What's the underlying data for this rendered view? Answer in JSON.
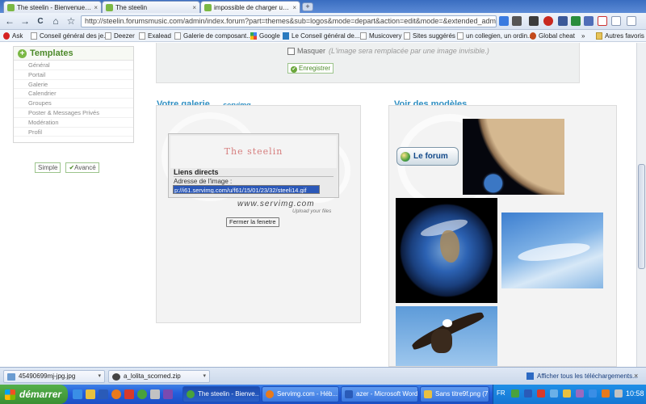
{
  "tabs": [
    {
      "label": "The steelin - Bienvenue sur...",
      "close": "×",
      "active": false
    },
    {
      "label": "The steelin",
      "close": "×",
      "active": false
    },
    {
      "label": "impossible de charger une i...",
      "close": "×",
      "active": true
    }
  ],
  "new_tab": "+",
  "toolbar": {
    "back": "←",
    "forward": "→",
    "reload": "C",
    "home": "⌂",
    "star": "☆",
    "url": "http://steelin.forumsmusic.com/admin/index.forum?part=themes&sub=logos&mode=depart&action=edit&mode=&extended_admin"
  },
  "bookmarks": [
    "Ask",
    "Conseil général des je...",
    "Deezer",
    "Exalead",
    "Galerie de composant...",
    "Google",
    "Le Conseil général de...",
    "Musicovery",
    "Sites suggérés",
    "un collegien, un ordin...",
    "Global cheat"
  ],
  "bookmarks_other": "Autres favoris",
  "templates": {
    "title": "Templates",
    "items": [
      "Général",
      "Portail",
      "Galerie",
      "Calendrier",
      "Groupes",
      "Poster & Messages Privés",
      "Modération",
      "Profil"
    ]
  },
  "modes": {
    "simple": "Simple",
    "advanced": "Avancé"
  },
  "mask": {
    "label": "Masquer",
    "hint": "(L'image sera remplacée par une image invisible.)"
  },
  "save_label": "Enregistrer",
  "gallery": {
    "title": "Votre galerie",
    "logo": "servimg",
    "preview_text": "The steelin",
    "direct_links": "Liens directs",
    "address_label": "Adresse de l'image :",
    "address_value": "p://i61.servimg.com/u/f61/15/01/23/32/steeli14.gif",
    "wordmark": "www.servimg.com",
    "tagline": "Upload your files",
    "close_button": "Fermer la fenetre"
  },
  "models": {
    "title": "Voir des modèles",
    "forum_button": "Le forum"
  },
  "downloads": [
    {
      "name": "45490699mj-jpg.jpg",
      "arrow": "▾"
    },
    {
      "name": "a_lolita_scorned.zip",
      "arrow": "▾"
    }
  ],
  "downloads_show_all": "Afficher tous les téléchargements...",
  "downloads_close": "×",
  "taskbar": {
    "start": "démarrer",
    "tasks": [
      "The steelin - Bienve...",
      "Servimg.com - Héb...",
      "azer - Microsoft Word",
      "Sans titre9f.png (7..."
    ],
    "lang": "FR",
    "clock": "10:58"
  },
  "colors": {
    "accent_blue": "#2f8fc2",
    "accent_green": "#4d8a2a",
    "taskbar_blue": "#245edb",
    "start_green": "#3a8f33"
  }
}
